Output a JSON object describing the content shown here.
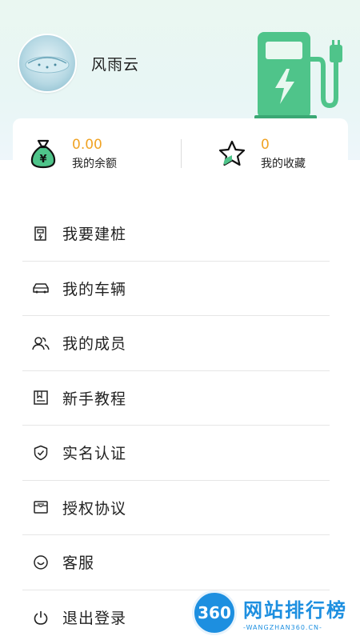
{
  "profile": {
    "username": "风雨云"
  },
  "stats": {
    "balance": {
      "value": "0.00",
      "label": "我的余额"
    },
    "favorites": {
      "value": "0",
      "label": "我的收藏"
    }
  },
  "menu": {
    "items": [
      {
        "label": "我要建桩",
        "icon": "charging-pile-icon"
      },
      {
        "label": "我的车辆",
        "icon": "car-icon"
      },
      {
        "label": "我的成员",
        "icon": "members-icon"
      },
      {
        "label": "新手教程",
        "icon": "book-icon"
      },
      {
        "label": "实名认证",
        "icon": "shield-check-icon"
      },
      {
        "label": "授权协议",
        "icon": "agreement-icon"
      },
      {
        "label": "客服",
        "icon": "customer-service-icon"
      },
      {
        "label": "退出登录",
        "icon": "power-icon"
      }
    ]
  },
  "watermark": {
    "logo": "360",
    "title": "网站排行榜",
    "url": "-WANGZHAN360.CN-"
  },
  "colors": {
    "accent": "#f0a324",
    "brand_green": "#3dbb7b",
    "watermark_blue": "#1d8fe0"
  }
}
